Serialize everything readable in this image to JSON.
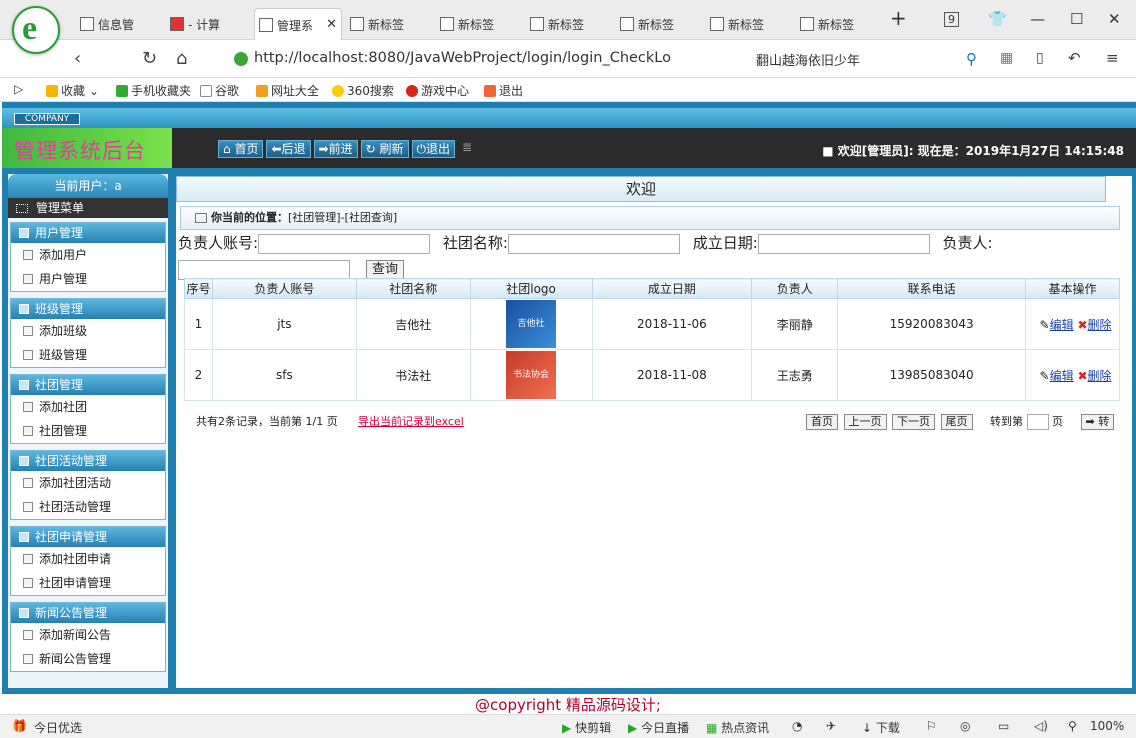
{
  "browser": {
    "tabs": [
      {
        "label": "信息管"
      },
      {
        "label": "- 计算"
      },
      {
        "label": "管理系"
      },
      {
        "label": "新标签"
      },
      {
        "label": "新标签"
      },
      {
        "label": "新标签"
      },
      {
        "label": "新标签"
      },
      {
        "label": "新标签"
      },
      {
        "label": "新标签"
      }
    ],
    "tab_count_badge": "9",
    "url": "http://localhost:8080/JavaWebProject/login/login_CheckLo",
    "search_query": "翻山越海依旧少年",
    "bookmarks": [
      "收藏",
      "手机收藏夹",
      "谷歌",
      "网址大全",
      "360搜索",
      "游戏中心",
      "退出"
    ],
    "status_left": "今日优选",
    "status_items": [
      "快剪辑",
      "今日直播",
      "热点资讯",
      "下载"
    ],
    "zoom": "100%"
  },
  "app": {
    "company": "COMPANY",
    "title": "管理系统后台",
    "toolbar": [
      "首页",
      "后退",
      "前进",
      "刷新",
      "退出"
    ],
    "welcome": "■ 欢迎[管理员]:  现在是：2019年1月27日 14:15:48",
    "current_user": "当前用户：a",
    "menu_head": "管理菜单",
    "groups": [
      {
        "title": "用户管理",
        "items": [
          "添加用户",
          "用户管理"
        ]
      },
      {
        "title": "班级管理",
        "items": [
          "添加班级",
          "班级管理"
        ]
      },
      {
        "title": "社团管理",
        "items": [
          "添加社团",
          "社团管理"
        ]
      },
      {
        "title": "社团活动管理",
        "items": [
          "添加社团活动",
          "社团活动管理"
        ]
      },
      {
        "title": "社团申请管理",
        "items": [
          "添加社团申请",
          "社团申请管理"
        ]
      },
      {
        "title": "新闻公告管理",
        "items": [
          "添加新闻公告",
          "新闻公告管理"
        ]
      }
    ],
    "welcome_bar": "欢迎",
    "position_label": "你当前的位置：",
    "position_path": "[社团管理]-[社团查询]",
    "form": {
      "account_label": "负责人账号:",
      "name_label": "社团名称:",
      "date_label": "成立日期:",
      "leader_label": "负责人:",
      "query_button": "查询"
    },
    "table": {
      "headers": [
        "序号",
        "负责人账号",
        "社团名称",
        "社团logo",
        "成立日期",
        "负责人",
        "联系电话",
        "基本操作"
      ],
      "rows": [
        {
          "no": "1",
          "account": "jts",
          "name": "吉他社",
          "logo_text": "吉他社",
          "logo_color": "#1f5fb0",
          "date": "2018-11-06",
          "leader": "李丽静",
          "phone": "15920083043",
          "edit": "编辑",
          "del": "删除"
        },
        {
          "no": "2",
          "account": "sfs",
          "name": "书法社",
          "logo_text": "书法协会",
          "logo_color": "#d9473a",
          "date": "2018-11-08",
          "leader": "王志勇",
          "phone": "13985083040",
          "edit": "编辑",
          "del": "删除"
        }
      ]
    },
    "pager": {
      "summary": "共有2条记录，当前第 1/1 页",
      "export": "导出当前记录到excel",
      "first": "首页",
      "prev": "上一页",
      "next": "下一页",
      "last": "尾页",
      "goto_label": "转到第",
      "goto_suffix": "页",
      "go": "➡ 转"
    },
    "footer": "@copyright 精品源码设计;"
  }
}
